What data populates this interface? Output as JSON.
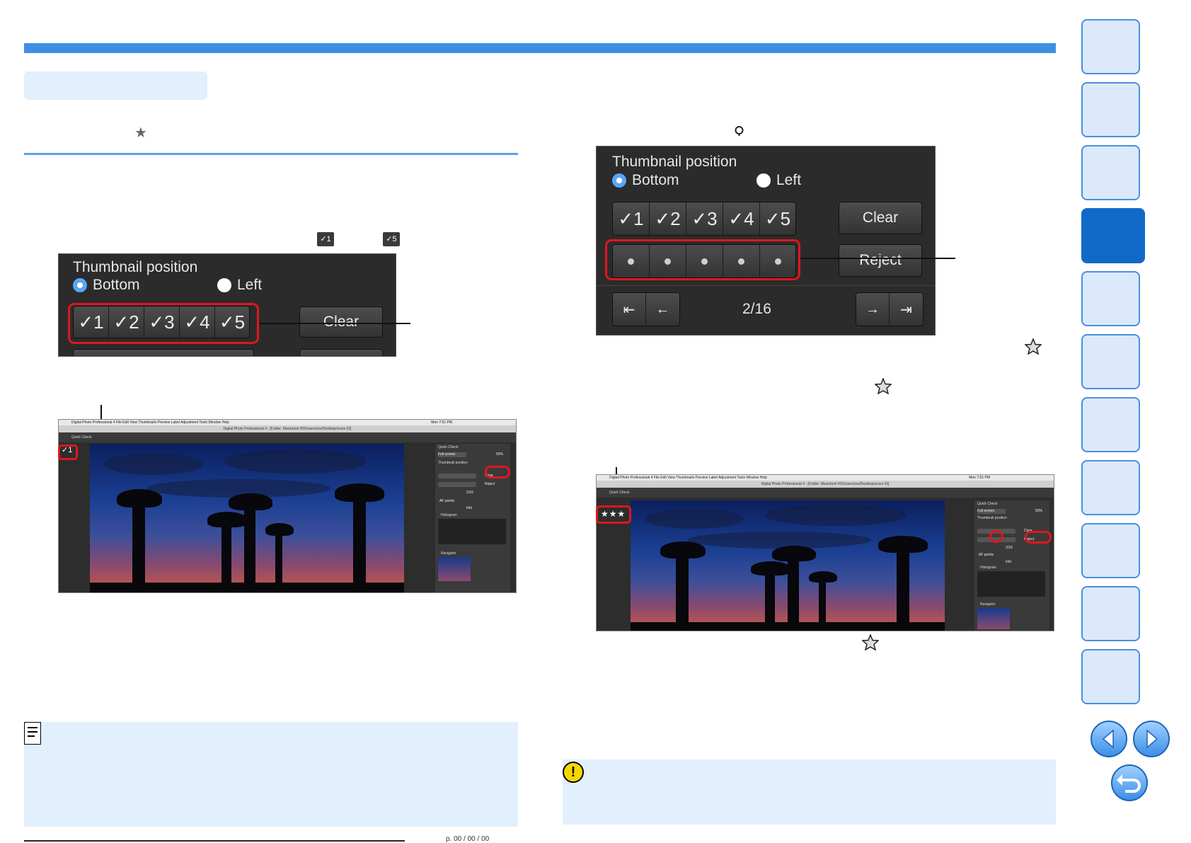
{
  "check_panel": {
    "title": "Thumbnail position",
    "radio_bottom": "Bottom",
    "radio_left": "Left",
    "checks": [
      "✓1",
      "✓2",
      "✓3",
      "✓4",
      "✓5"
    ],
    "clear": "Clear"
  },
  "mini_keys": {
    "first": "✓1",
    "last": "✓5"
  },
  "rating_panel": {
    "title": "Thumbnail position",
    "radio_bottom": "Bottom",
    "radio_left": "Left",
    "checks": [
      "✓1",
      "✓2",
      "✓3",
      "✓4",
      "✓5"
    ],
    "clear": "Clear",
    "reject": "Reject",
    "counter": "2/16"
  },
  "screenshot_left": {
    "app_menu": "Digital Photo Professional 4   File   Edit   View   Thumbnails   Preview   Label   Adjustment   Tools   Window   Help",
    "clock": "Mon 7:51 PM",
    "window_title": "Digital Photo Professional 4 - [Folder: Macintosh HD/Users/xxx/Desktop/xxxxx 03]",
    "toolbar_label": "Quick Check",
    "badge": "✓1",
    "side_title": "Quick Check",
    "side_full": "Full screen",
    "side_zoom": "50%",
    "side_thumb": "Thumbnail position",
    "side_clear": "Clear",
    "side_reject": "Reject",
    "side_counter": "2/16",
    "side_af": "AF points",
    "side_info": "Info",
    "side_histogram": "Histogram",
    "side_navigator": "Navigator"
  },
  "screenshot_right": {
    "app_menu": "Digital Photo Professional 4   File   Edit   View   Thumbnails   Preview   Label   Adjustment   Tools   Window   Help",
    "clock": "Mon 7:51 PM",
    "window_title": "Digital Photo Professional 4 - [Folder: Macintosh HD/Users/xxx/Desktop/xxxxx 03]",
    "toolbar_label": "Quick Check",
    "badge": "★★★",
    "side_title": "Quick Check",
    "side_full": "Full screen",
    "side_zoom": "50%",
    "side_thumb": "Thumbnail position",
    "side_clear": "Clear",
    "side_reject": "Reject",
    "side_counter": "2/16",
    "side_af": "AF points",
    "side_info": "Info",
    "side_histogram": "Histogram",
    "side_navigator": "Navigator"
  },
  "icons": {
    "heading_star": "star-icon",
    "outline_star": "outline-star-icon",
    "note": "memo-icon",
    "caution": "caution-icon",
    "prev": "previous-page-icon",
    "next": "next-page-icon",
    "back": "return-icon"
  },
  "page_footer": "p. 00 / 00 / 00"
}
